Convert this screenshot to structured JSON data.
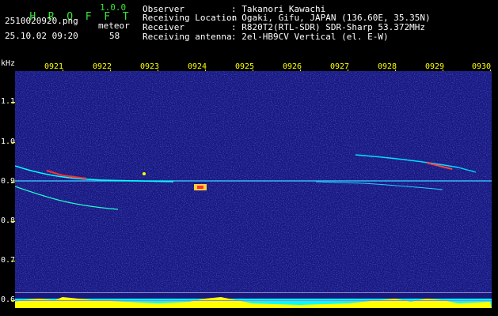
{
  "app": {
    "title_letters": [
      "H",
      "R",
      "O",
      "F",
      "F",
      "T"
    ],
    "version": "1.0.0",
    "filename": "2510020920.png",
    "datetime": "25.10.02 09:20",
    "event_type": "meteor",
    "count": "58"
  },
  "info": {
    "observer_label": "Observer",
    "observer_value": ": Takanori Kawachi",
    "location_label": "Receiving Location",
    "location_value": ": Ogaki, Gifu, JAPAN (136.60E, 35.35N)",
    "receiver_label": "Receiver",
    "receiver_value": ": R820T2(RTL-SDR) SDR-Sharp 53.372MHz",
    "antenna_label": "Receiving antenna",
    "antenna_value": ": 2el-HB9CV Vertical (el. E-W)"
  },
  "axes": {
    "y_unit": "kHz",
    "y_ticks": [
      "1.1",
      "1.0",
      "0.9",
      "0.8",
      "0.7",
      "0.6"
    ],
    "x_ticks": [
      "0921",
      "0922",
      "0923",
      "0924",
      "0925",
      "0926",
      "0927",
      "0928",
      "0929",
      "0930"
    ]
  },
  "colors": {
    "background": "#000000",
    "spectrogram_bg": "#1a1a86",
    "header_green": "#36e436",
    "tick_yellow": "#ffff00",
    "signal_cyan": "#00ffff",
    "signal_red": "#ff3030"
  }
}
